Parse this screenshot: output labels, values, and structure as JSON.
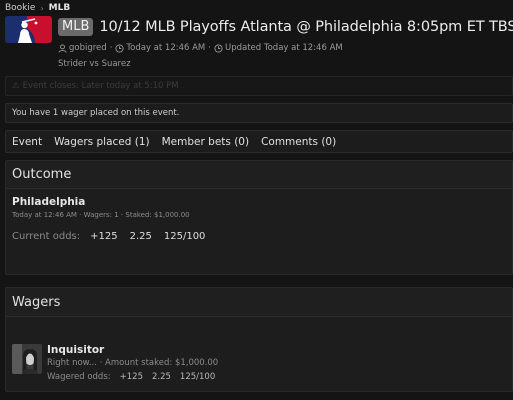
{
  "breadcrumb": {
    "items": [
      "Bookie",
      "MLB"
    ]
  },
  "event": {
    "badge": "MLB",
    "title": "10/12 MLB Playoffs Atlanta @ Philadelphia 8:05pm ET TBS",
    "author": "gobigred",
    "posted": "Today at 12:46 AM",
    "updated": "Updated Today at 12:46 AM",
    "subtitle": "Strider vs Suarez"
  },
  "notices": {
    "faded": "Event closes: Later today at 5:10 PM",
    "wager_count": "You have 1 wager placed on this event."
  },
  "tabs": [
    "Event",
    "Wagers placed (1)",
    "Member bets (0)",
    "Comments (0)"
  ],
  "outcome": {
    "heading": "Outcome",
    "name": "Philadelphia",
    "meta": "Today at 12:46 AM · Wagers: 1 · Staked: $1,000.00",
    "odds_label": "Current odds:",
    "odds": [
      "+125",
      "2.25",
      "125/100"
    ]
  },
  "wagers": {
    "heading": "Wagers",
    "user": "Inquisitor",
    "line": "Right now... · Amount staked: $1,000.00",
    "odds_label": "Wagered odds:",
    "odds": [
      "+125",
      "2.25",
      "125/100"
    ]
  },
  "colors": {
    "logo_blue": "#1b2f6e",
    "logo_red": "#c8102e",
    "background": "#141414"
  }
}
